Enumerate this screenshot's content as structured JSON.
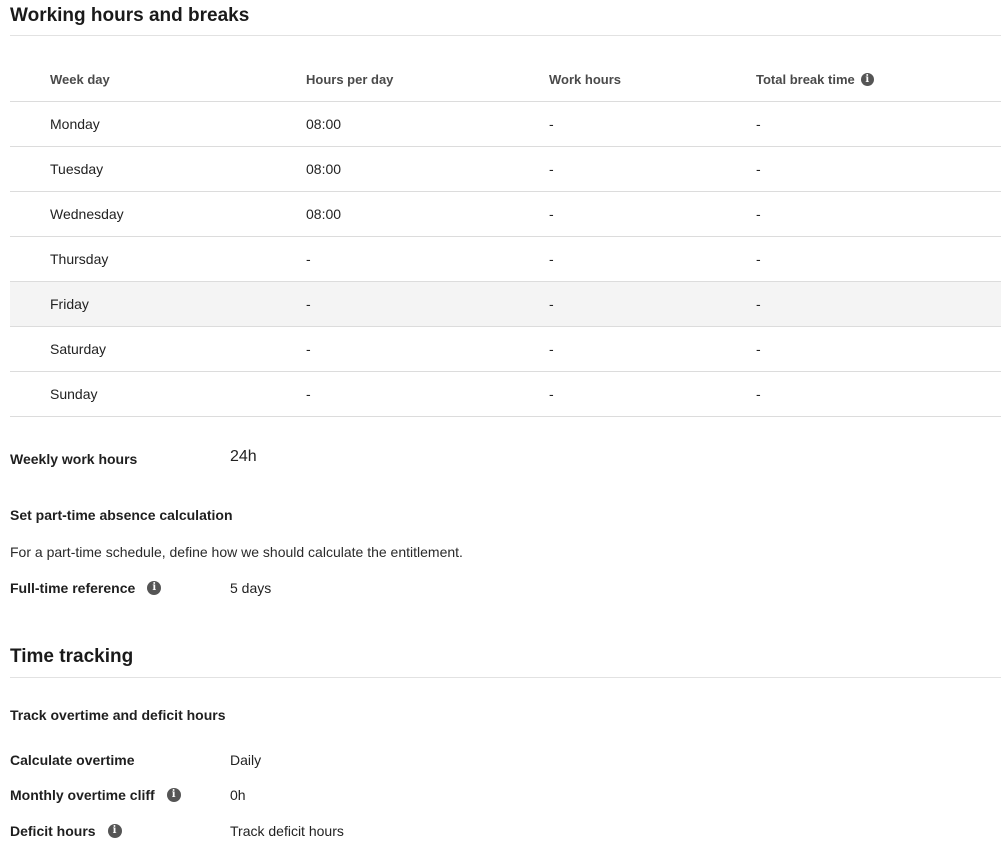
{
  "working_hours": {
    "title": "Working hours and breaks",
    "columns": [
      "Week day",
      "Hours per day",
      "Work hours",
      "Total break time"
    ],
    "rows": [
      {
        "day": "Monday",
        "hours_per_day": "08:00",
        "work_hours": "-",
        "total_break": "-"
      },
      {
        "day": "Tuesday",
        "hours_per_day": "08:00",
        "work_hours": "-",
        "total_break": "-"
      },
      {
        "day": "Wednesday",
        "hours_per_day": "08:00",
        "work_hours": "-",
        "total_break": "-"
      },
      {
        "day": "Thursday",
        "hours_per_day": "-",
        "work_hours": "-",
        "total_break": "-"
      },
      {
        "day": "Friday",
        "hours_per_day": "-",
        "work_hours": "-",
        "total_break": "-"
      },
      {
        "day": "Saturday",
        "hours_per_day": "-",
        "work_hours": "-",
        "total_break": "-"
      },
      {
        "day": "Sunday",
        "hours_per_day": "-",
        "work_hours": "-",
        "total_break": "-"
      }
    ],
    "weekly_label": "Weekly work hours",
    "weekly_value": "24h"
  },
  "part_time": {
    "heading": "Set part-time absence calculation",
    "description": "For a part-time schedule, define how we should calculate the entitlement.",
    "reference_label": "Full-time reference",
    "reference_value": "5 days"
  },
  "time_tracking": {
    "title": "Time tracking",
    "subheading": "Track overtime and deficit hours",
    "overtime_label": "Calculate overtime",
    "overtime_value": "Daily",
    "cliff_label": "Monthly overtime cliff",
    "cliff_value": "0h",
    "deficit_label": "Deficit hours",
    "deficit_value": "Track deficit hours"
  },
  "icons": {
    "info": "info-icon"
  }
}
